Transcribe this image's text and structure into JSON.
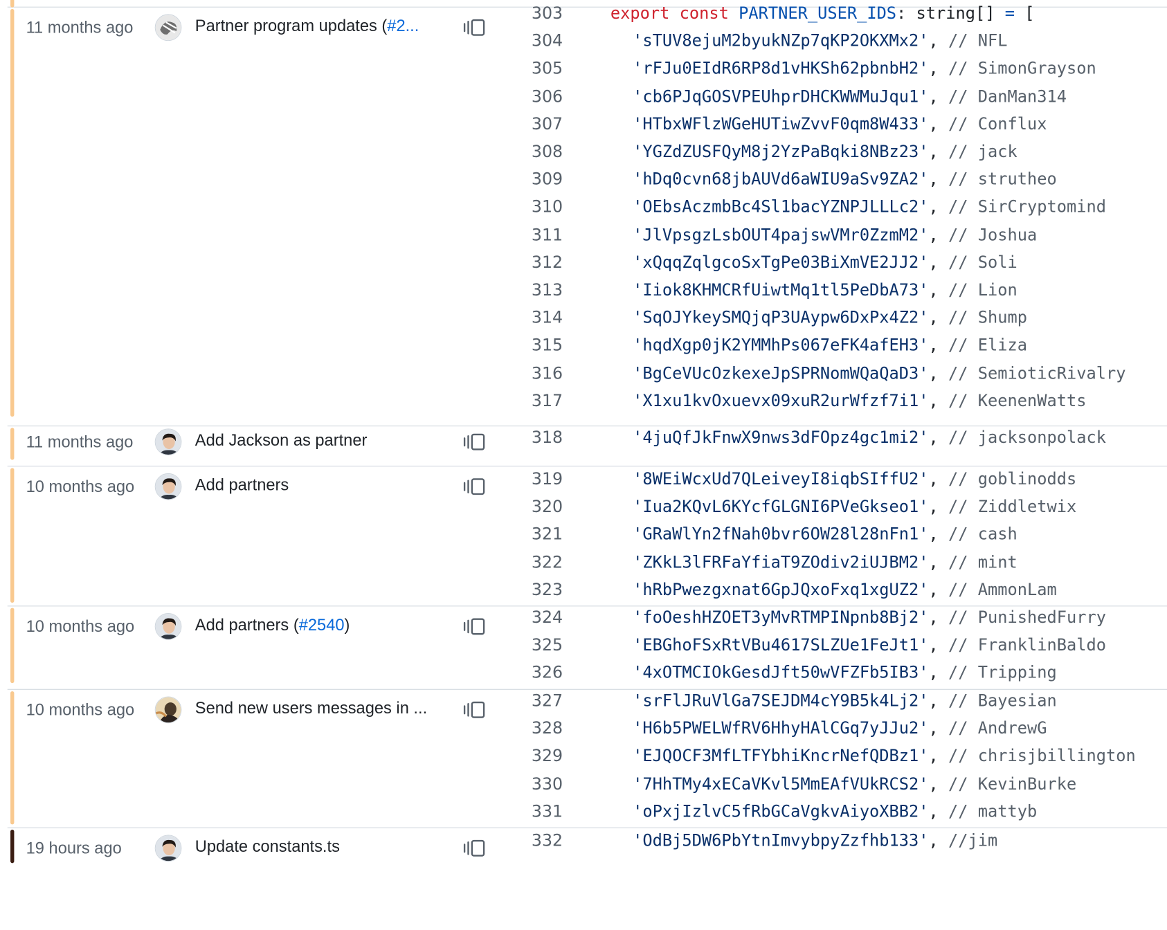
{
  "colors": {
    "age_bar_old": "#f9c98f",
    "age_bar_recent": "#3a1d12",
    "link": "#0969da"
  },
  "blocks": [
    {
      "time": "11 months ago",
      "message": "Partner program updates (",
      "pr": "#2...",
      "pr_close": "",
      "lines": [
        {
          "n": "303",
          "kind": "decl"
        },
        {
          "n": "304",
          "id": "'sTUV8ejuM2byukNZp7qKP2OKXMx2'",
          "cmt": "// NFL"
        },
        {
          "n": "305",
          "id": "'rFJu0EIdR6RP8d1vHKSh62pbnbH2'",
          "cmt": "// SimonGrayson"
        },
        {
          "n": "306",
          "id": "'cb6PJqGOSVPEUhprDHCKWWMuJqu1'",
          "cmt": "// DanMan314"
        },
        {
          "n": "307",
          "id": "'HTbxWFlzWGeHUTiwZvvF0qm8W433'",
          "cmt": "// Conflux"
        },
        {
          "n": "308",
          "id": "'YGZdZUSFQyM8j2YzPaBqki8NBz23'",
          "cmt": "// jack"
        },
        {
          "n": "309",
          "id": "'hDq0cvn68jbAUVd6aWIU9aSv9ZA2'",
          "cmt": "// strutheo"
        },
        {
          "n": "310",
          "id": "'OEbsAczmbBc4Sl1bacYZNPJLLLc2'",
          "cmt": "// SirCryptomind"
        },
        {
          "n": "311",
          "id": "'JlVpsgzLsbOUT4pajswVMr0ZzmM2'",
          "cmt": "// Joshua"
        },
        {
          "n": "312",
          "id": "'xQqqZqlgcoSxTgPe03BiXmVE2JJ2'",
          "cmt": "// Soli"
        },
        {
          "n": "313",
          "id": "'Iiok8KHMCRfUiwtMq1tl5PeDbA73'",
          "cmt": "// Lion"
        },
        {
          "n": "314",
          "id": "'SqOJYkeySMQjqP3UAypw6DxPx4Z2'",
          "cmt": "// Shump"
        },
        {
          "n": "315",
          "id": "'hqdXgp0jK2YMMhPs067eFK4afEH3'",
          "cmt": "// Eliza"
        },
        {
          "n": "316",
          "id": "'BgCeVUcOzkexeJpSPRNomWQaQaD3'",
          "cmt": "// SemioticRivalry"
        },
        {
          "n": "317",
          "id": "'X1xu1kvOxuevx09xuR2urWfzf7i1'",
          "cmt": "// KeenenWatts"
        }
      ]
    },
    {
      "time": "11 months ago",
      "message": "Add Jackson as partner",
      "pr": "",
      "pr_close": "",
      "lines": [
        {
          "n": "318",
          "id": "'4juQfJkFnwX9nws3dFOpz4gc1mi2'",
          "cmt": "// jacksonpolack"
        }
      ]
    },
    {
      "time": "10 months ago",
      "message": "Add partners",
      "pr": "",
      "pr_close": "",
      "lines": [
        {
          "n": "319",
          "id": "'8WEiWcxUd7QLeiveyI8iqbSIffU2'",
          "cmt": "// goblinodds"
        },
        {
          "n": "320",
          "id": "'Iua2KQvL6KYcfGLGNI6PVeGkseo1'",
          "cmt": "// Ziddletwix"
        },
        {
          "n": "321",
          "id": "'GRaWlYn2fNah0bvr6OW28l28nFn1'",
          "cmt": "// cash"
        },
        {
          "n": "322",
          "id": "'ZKkL3lFRFaYfiaT9ZOdiv2iUJBM2'",
          "cmt": "// mint"
        },
        {
          "n": "323",
          "id": "'hRbPwezgxnat6GpJQxoFxq1xgUZ2'",
          "cmt": "// AmmonLam"
        }
      ]
    },
    {
      "time": "10 months ago",
      "message": "Add partners (",
      "pr": "#2540",
      "pr_close": ")",
      "lines": [
        {
          "n": "324",
          "id": "'foOeshHZOET3yMvRTMPINpnb8Bj2'",
          "cmt": "// PunishedFurry"
        },
        {
          "n": "325",
          "id": "'EBGhoFSxRtVBu4617SLZUe1FeJt1'",
          "cmt": "// FranklinBaldo"
        },
        {
          "n": "326",
          "id": "'4xOTMCIOkGesdJft50wVFZFb5IB3'",
          "cmt": "// Tripping"
        }
      ]
    },
    {
      "time": "10 months ago",
      "message": "Send new users messages in ...",
      "pr": "",
      "pr_close": "",
      "lines": [
        {
          "n": "327",
          "id": "'srFlJRuVlGa7SEJDM4cY9B5k4Lj2'",
          "cmt": "// Bayesian"
        },
        {
          "n": "328",
          "id": "'H6b5PWELWfRV6HhyHAlCGq7yJJu2'",
          "cmt": "// AndrewG"
        },
        {
          "n": "329",
          "id": "'EJQOCF3MfLTFYbhiKncrNefQDBz1'",
          "cmt": "// chrisjbillington"
        },
        {
          "n": "330",
          "id": "'7HhTMy4xECaVKvl5MmEAfVUkRCS2'",
          "cmt": "// KevinBurke"
        },
        {
          "n": "331",
          "id": "'oPxjIzlvC5fRbGCaVgkvAiyoXBB2'",
          "cmt": "// mattyb"
        }
      ]
    },
    {
      "time": "19 hours ago",
      "message": "Update constants.ts",
      "pr": "",
      "pr_close": "",
      "lines": [
        {
          "n": "332",
          "id": "'OdBj5DW6PbYtnImvybpyZzfhb133'",
          "cmt": "//jim"
        }
      ]
    }
  ],
  "decl": {
    "export": "export",
    "const": "const",
    "name": "PARTNER_USER_IDS",
    "type": ": string[] ",
    "eq": "=",
    "open": " ["
  },
  "separator": ", "
}
